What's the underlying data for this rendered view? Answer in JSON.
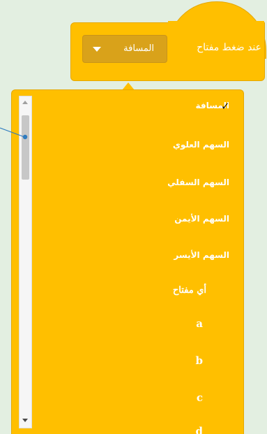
{
  "block": {
    "text": "عند ضغط مفتاح",
    "dropdown_value": "المسافة",
    "icon": "dropdown-arrow"
  },
  "menu": {
    "checked_icon": "✓",
    "items": [
      {
        "label": "المسافة",
        "selected": true
      },
      {
        "label": "السهم العلوي",
        "selected": false
      },
      {
        "label": "السهم السفلي",
        "selected": false
      },
      {
        "label": "السهم الأيمن",
        "selected": false
      },
      {
        "label": "السهم الأيسر",
        "selected": false
      },
      {
        "label": "أي مفتاح",
        "selected": false
      },
      {
        "label": "a",
        "selected": false
      },
      {
        "label": "b",
        "selected": false
      },
      {
        "label": "c",
        "selected": false
      },
      {
        "label": "d",
        "selected": false
      }
    ]
  },
  "colors": {
    "block": "#ffbf00",
    "block_border": "#e6a800",
    "dropdown_field": "#d9a21a",
    "background": "#e3efe1",
    "callout": "#2e7bbf"
  }
}
